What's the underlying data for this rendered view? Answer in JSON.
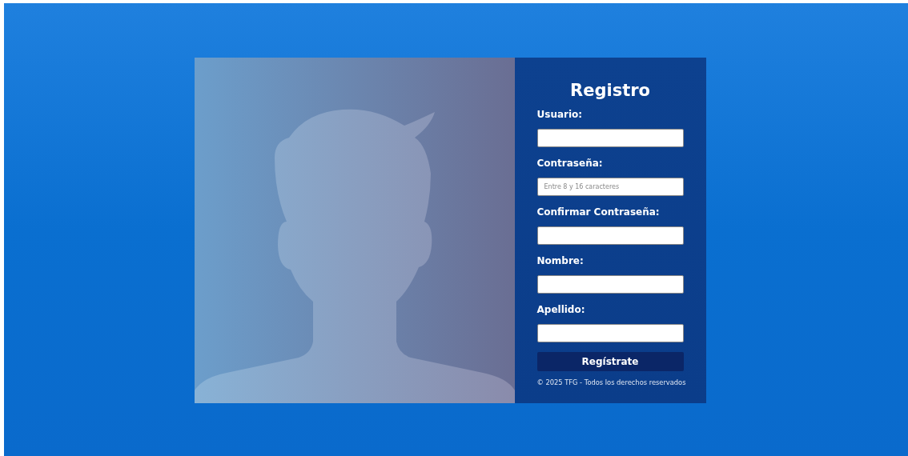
{
  "form": {
    "title": "Registro",
    "fields": [
      {
        "label": "Usuario:"
      },
      {
        "label": "Contraseña:",
        "placeholder": "Entre 8 y 16 caracteres"
      },
      {
        "label": "Confirmar Contraseña:"
      },
      {
        "label": "Nombre:"
      },
      {
        "label": "Apellido:"
      }
    ],
    "submit": "Regístrate",
    "footer": "© 2025 TFG - Todos los derechos reservados"
  }
}
